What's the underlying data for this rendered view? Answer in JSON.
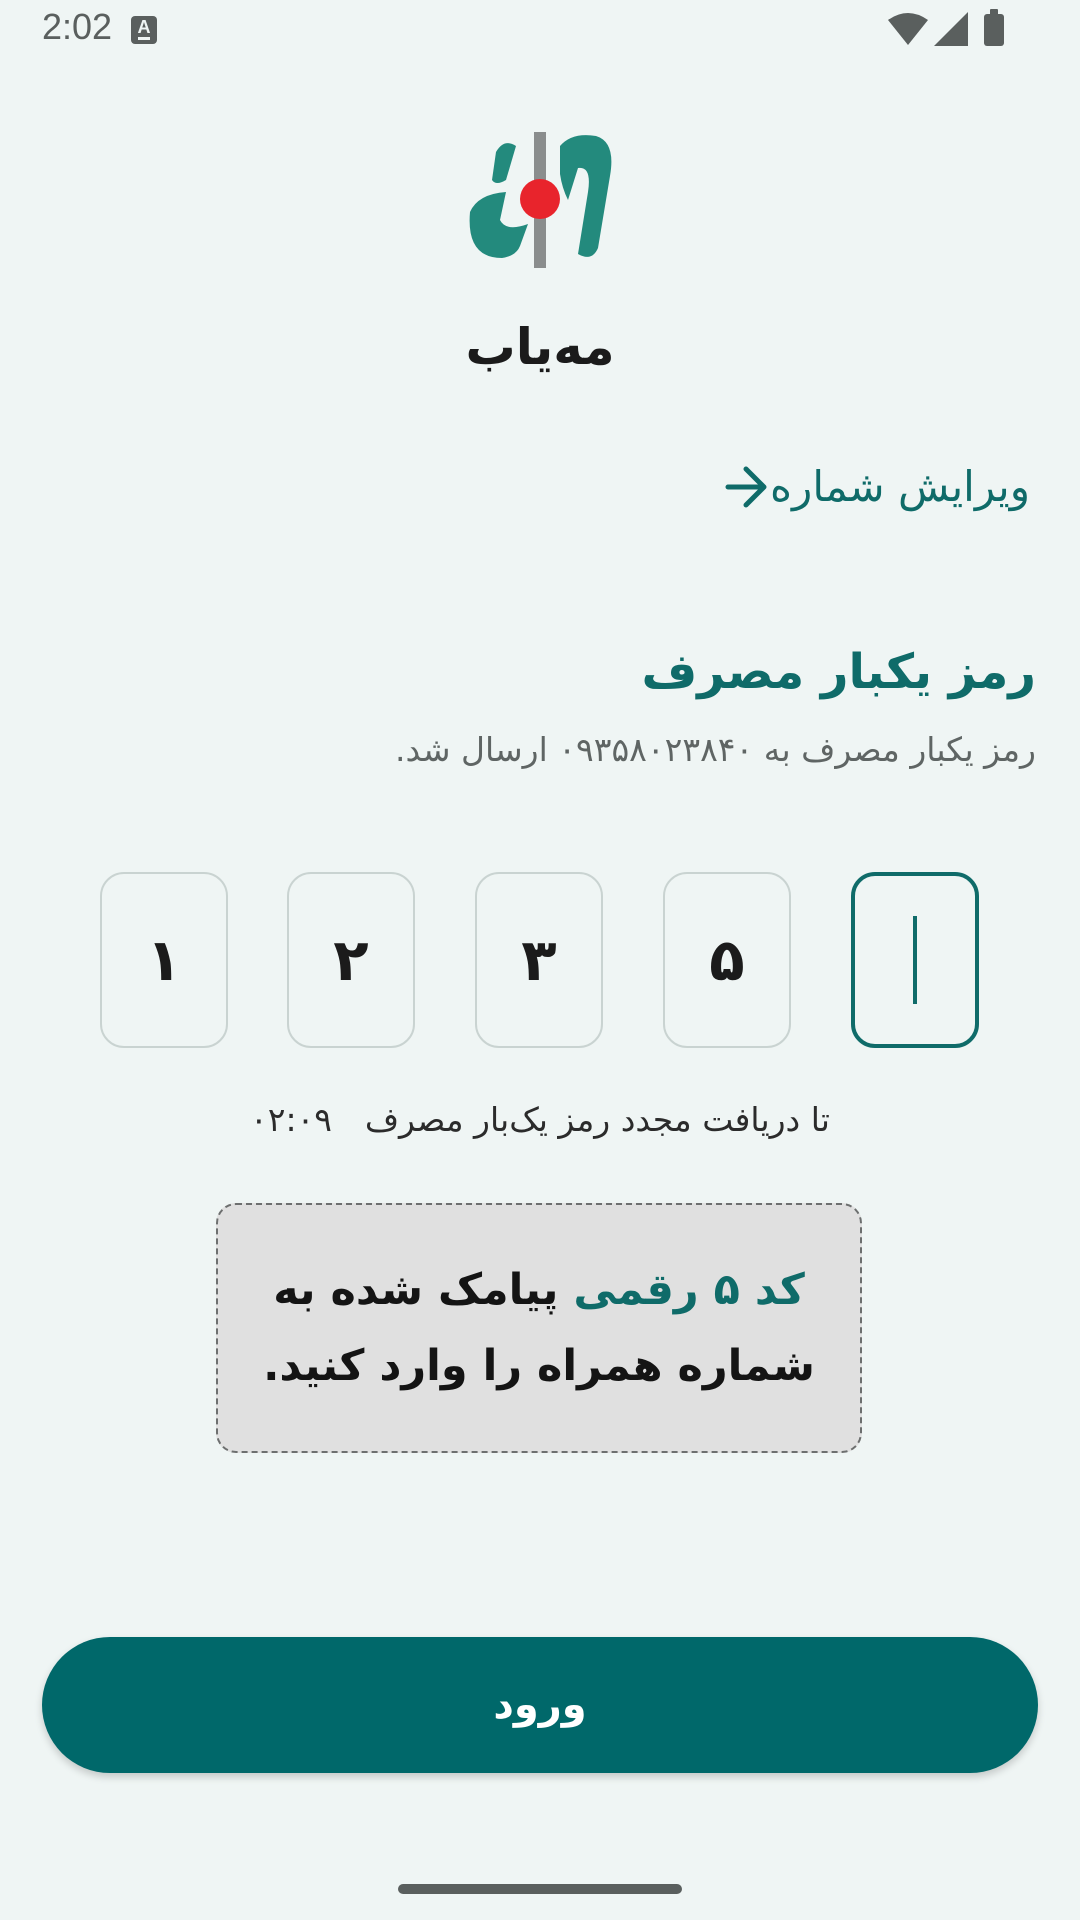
{
  "status_bar": {
    "time": "2:02",
    "notification_icon": "a-icon",
    "icons": [
      "wifi-icon",
      "signal-icon",
      "battery-icon"
    ]
  },
  "brand": {
    "name": "مه‌یاب"
  },
  "edit_number": {
    "label": "ویرایش شماره",
    "icon": "arrow-right-icon"
  },
  "otp": {
    "title": "رمز یکبار مصرف",
    "subtitle": "رمز یکبار مصرف به ۰۹۳۵۸۰۲۳۸۴۰ ارسال شد.",
    "digits": [
      "۱",
      "۲",
      "۳",
      "۵",
      ""
    ]
  },
  "resend": {
    "label": "تا دریافت مجدد رمز یک‌بار مصرف",
    "timer": "۰۲:۰۹"
  },
  "hint": {
    "accent": "کد ۵ رقمی",
    "rest": " پیامک شده به شماره همراه را وارد کنید."
  },
  "login_button": {
    "label": "ورود"
  },
  "colors": {
    "primary": "#0f6b69",
    "button": "#00686a",
    "background": "#eff5f4",
    "logo_red": "#e8242c",
    "logo_green": "#238a7d"
  }
}
